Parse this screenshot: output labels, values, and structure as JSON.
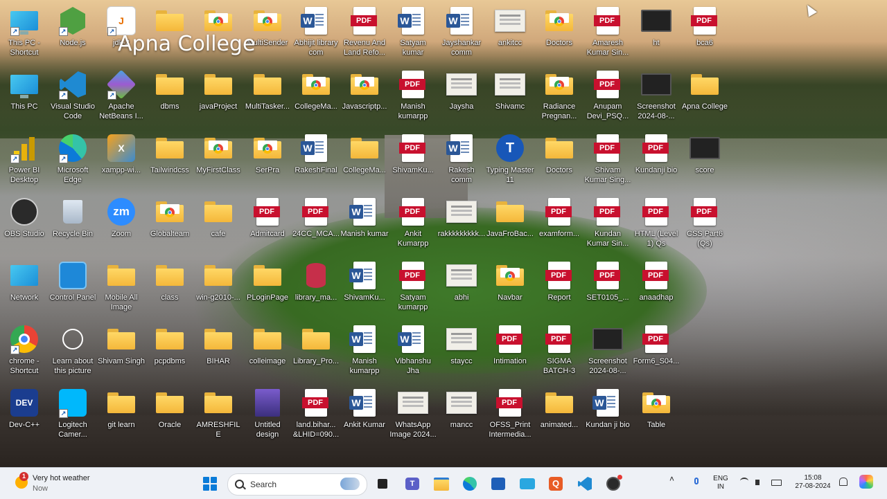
{
  "watermark": "Apna College",
  "desktop_icons": [
    {
      "name": "this-pc-shortcut-icon",
      "label": "This PC - Shortcut",
      "type": "pc",
      "shortcut": true
    },
    {
      "name": "nodejs-icon",
      "label": "Node.js",
      "type": "node",
      "shortcut": true
    },
    {
      "name": "jdk-icon",
      "label": "jdk-2",
      "type": "java",
      "shortcut": true
    },
    {
      "name": "folder-icon",
      "label": "",
      "type": "folder"
    },
    {
      "name": "folder-chrome-icon",
      "label": "",
      "type": "folder-chrome"
    },
    {
      "name": "folder-chrome-icon",
      "label": "MultiSender",
      "type": "folder-chrome"
    },
    {
      "name": "word-doc-icon",
      "label": "Abhijit library com",
      "type": "word"
    },
    {
      "name": "pdf-icon",
      "label": "Revenu And Land Refo...",
      "type": "pdf"
    },
    {
      "name": "word-doc-icon",
      "label": "Satyam kumar",
      "type": "word"
    },
    {
      "name": "word-doc-icon",
      "label": "Jayshankar comm",
      "type": "word"
    },
    {
      "name": "image-icon",
      "label": "ankitcc",
      "type": "cert"
    },
    {
      "name": "folder-chrome-icon",
      "label": "Doctors",
      "type": "folder-chrome"
    },
    {
      "name": "pdf-icon",
      "label": "Amaresh Kumar Sin...",
      "type": "pdf"
    },
    {
      "name": "screen-image-icon",
      "label": "ht",
      "type": "screen"
    },
    {
      "name": "pdf-icon",
      "label": "bca6",
      "type": "pdf"
    },
    {
      "name": "this-pc-icon",
      "label": "This PC",
      "type": "pc"
    },
    {
      "name": "vscode-icon",
      "label": "Visual Studio Code",
      "type": "vscode",
      "shortcut": true
    },
    {
      "name": "netbeans-icon",
      "label": "Apache NetBeans I...",
      "type": "netbeans",
      "shortcut": true
    },
    {
      "name": "folder-icon",
      "label": "dbms",
      "type": "folder"
    },
    {
      "name": "folder-icon",
      "label": "javaProject",
      "type": "folder"
    },
    {
      "name": "folder-icon",
      "label": "MultiTasker...",
      "type": "folder"
    },
    {
      "name": "folder-edge-icon",
      "label": "CollegeMa...",
      "type": "folder-chrome"
    },
    {
      "name": "folder-chrome-icon",
      "label": "Javascriptp...",
      "type": "folder-chrome"
    },
    {
      "name": "pdf-icon",
      "label": "Manish kumarpp",
      "type": "pdf"
    },
    {
      "name": "image-icon",
      "label": "Jaysha",
      "type": "cert"
    },
    {
      "name": "image-icon",
      "label": "Shivamc",
      "type": "cert"
    },
    {
      "name": "folder-chrome-icon",
      "label": "Radiance Pregnan...",
      "type": "folder-chrome"
    },
    {
      "name": "pdf-icon",
      "label": "Anupam Devi_PSQ...",
      "type": "pdf"
    },
    {
      "name": "screen-image-icon",
      "label": "Screenshot 2024-08-...",
      "type": "screen"
    },
    {
      "name": "folder-icon",
      "label": "Apna College",
      "type": "folder"
    },
    {
      "name": "powerbi-icon",
      "label": "Power BI Desktop",
      "type": "powerbi",
      "shortcut": true
    },
    {
      "name": "edge-icon",
      "label": "Microsoft Edge",
      "type": "edge",
      "shortcut": true
    },
    {
      "name": "xampp-icon",
      "label": "xampp-wi...",
      "type": "xampp"
    },
    {
      "name": "folder-icon",
      "label": "Tailwindcss",
      "type": "folder"
    },
    {
      "name": "folder-chrome-icon",
      "label": "MyFirstClass",
      "type": "folder-chrome"
    },
    {
      "name": "folder-chrome-icon",
      "label": "SerPra",
      "type": "folder-chrome"
    },
    {
      "name": "word-doc-icon",
      "label": "RakeshFinal",
      "type": "word"
    },
    {
      "name": "folder-icon",
      "label": "CollegeMa...",
      "type": "folder"
    },
    {
      "name": "pdf-icon",
      "label": "ShivamKu...",
      "type": "pdf"
    },
    {
      "name": "word-doc-icon",
      "label": "Rakesh comm",
      "type": "word"
    },
    {
      "name": "typing-master-icon",
      "label": "Typing Master 11",
      "type": "typing"
    },
    {
      "name": "folder-icon",
      "label": "Doctors",
      "type": "folder"
    },
    {
      "name": "pdf-icon",
      "label": "Shivam Kumar Sing...",
      "type": "pdf"
    },
    {
      "name": "pdf-icon",
      "label": "Kundanji bio",
      "type": "pdf"
    },
    {
      "name": "screen-image-icon",
      "label": "score",
      "type": "screen"
    },
    {
      "name": "obs-icon",
      "label": "OBS Studio",
      "type": "obs"
    },
    {
      "name": "recycle-bin-icon",
      "label": "Recycle Bin",
      "type": "recycle"
    },
    {
      "name": "zoom-icon",
      "label": "Zoom",
      "type": "zoom"
    },
    {
      "name": "folder-chrome-icon",
      "label": "Globalteam",
      "type": "folder-chrome"
    },
    {
      "name": "folder-icon",
      "label": "cafe",
      "type": "folder"
    },
    {
      "name": "pdf-icon",
      "label": "Admitcard",
      "type": "pdf"
    },
    {
      "name": "pdf-icon",
      "label": "24CC_MCA...",
      "type": "pdf"
    },
    {
      "name": "word-doc-icon",
      "label": "Manish kumar",
      "type": "word"
    },
    {
      "name": "pdf-icon",
      "label": "Ankit Kumarpp",
      "type": "pdf"
    },
    {
      "name": "image-icon",
      "label": "rakkkkkkkkk...",
      "type": "cert"
    },
    {
      "name": "folder-icon",
      "label": "JavaFroBac...",
      "type": "folder"
    },
    {
      "name": "pdf-icon",
      "label": "examform...",
      "type": "pdf"
    },
    {
      "name": "pdf-icon",
      "label": "Kundan Kumar Sin...",
      "type": "pdf"
    },
    {
      "name": "pdf-icon",
      "label": "HTML (Level 1) Qs",
      "type": "pdf"
    },
    {
      "name": "pdf-icon",
      "label": "CSS Part6 (Qs)",
      "type": "pdf"
    },
    {
      "name": "network-icon",
      "label": "Network",
      "type": "network"
    },
    {
      "name": "control-panel-icon",
      "label": "Control Panel",
      "type": "control"
    },
    {
      "name": "folder-icon",
      "label": "Mobile All Image",
      "type": "folder"
    },
    {
      "name": "folder-icon",
      "label": "class",
      "type": "folder"
    },
    {
      "name": "folder-icon",
      "label": "win-g2010-...",
      "type": "folder"
    },
    {
      "name": "folder-icon",
      "label": "PLoginPage",
      "type": "folder"
    },
    {
      "name": "database-icon",
      "label": "library_ma...",
      "type": "database"
    },
    {
      "name": "word-doc-icon",
      "label": "ShivamKu...",
      "type": "word"
    },
    {
      "name": "pdf-icon",
      "label": "Satyam kumarpp",
      "type": "pdf"
    },
    {
      "name": "image-icon",
      "label": "abhi",
      "type": "cert"
    },
    {
      "name": "folder-chrome-icon",
      "label": "Navbar",
      "type": "folder-chrome"
    },
    {
      "name": "pdf-icon",
      "label": "Report",
      "type": "pdf"
    },
    {
      "name": "pdf-icon",
      "label": "SET0105_...",
      "type": "pdf"
    },
    {
      "name": "pdf-icon",
      "label": "anaadhap",
      "type": "pdf"
    },
    {
      "name": "chrome-icon",
      "label": "chrome - Shortcut",
      "type": "chrome",
      "shortcut": true
    },
    {
      "name": "learn-about-picture-icon",
      "label": "Learn about this picture",
      "type": "learn"
    },
    {
      "name": "folder-icon",
      "label": "Shivam Singh",
      "type": "folder"
    },
    {
      "name": "folder-icon",
      "label": "pcpdbms",
      "type": "folder"
    },
    {
      "name": "folder-icon",
      "label": "BIHAR",
      "type": "folder"
    },
    {
      "name": "folder-icon",
      "label": "colleimage",
      "type": "folder"
    },
    {
      "name": "folder-icon",
      "label": "Library_Pro...",
      "type": "folder"
    },
    {
      "name": "word-doc-icon",
      "label": "Manish kumarpp",
      "type": "word"
    },
    {
      "name": "word-doc-icon",
      "label": "Vibhanshu Jha",
      "type": "word"
    },
    {
      "name": "image-icon",
      "label": "staycc",
      "type": "cert"
    },
    {
      "name": "pdf-icon",
      "label": "Intimation",
      "type": "pdf"
    },
    {
      "name": "pdf-icon",
      "label": "SIGMA BATCH-3",
      "type": "pdf"
    },
    {
      "name": "screen-image-icon",
      "label": "Screenshot 2024-08-...",
      "type": "screen"
    },
    {
      "name": "pdf-icon",
      "label": "Form6_S04...",
      "type": "pdf"
    },
    {
      "name": "devcpp-icon",
      "label": "Dev-C++",
      "type": "dev"
    },
    {
      "name": "logitech-camera-icon",
      "label": "Logitech Camer...",
      "type": "logi",
      "shortcut": true
    },
    {
      "name": "folder-icon",
      "label": "git learn",
      "type": "folder"
    },
    {
      "name": "folder-icon",
      "label": "Oracle",
      "type": "folder"
    },
    {
      "name": "folder-icon",
      "label": "AMRESHFILE",
      "type": "folder"
    },
    {
      "name": "avatar-image-icon",
      "label": "Untitled design",
      "type": "avatar"
    },
    {
      "name": "pdf-icon",
      "label": "land.bihar... &LHID=090...",
      "type": "pdf"
    },
    {
      "name": "word-doc-icon",
      "label": "Ankit Kumar",
      "type": "word"
    },
    {
      "name": "image-icon",
      "label": "WhatsApp Image 2024...",
      "type": "cert"
    },
    {
      "name": "image-icon",
      "label": "mancc",
      "type": "cert"
    },
    {
      "name": "pdf-icon",
      "label": "OFSS_Print Intermedia...",
      "type": "pdf"
    },
    {
      "name": "folder-icon",
      "label": "animated...",
      "type": "folder"
    },
    {
      "name": "word-doc-icon",
      "label": "Kundan ji bio",
      "type": "word"
    },
    {
      "name": "folder-chrome-icon",
      "label": "Table",
      "type": "folder-chrome"
    }
  ],
  "taskbar": {
    "weather_title": "Very hot weather",
    "weather_sub": "Now",
    "weather_badge": "1",
    "search_placeholder": "Search",
    "pinned": [
      "task-view-icon",
      "teams-icon",
      "file-explorer-icon",
      "edge-icon",
      "store-icon",
      "app-icon",
      "quiz-icon",
      "vscode-icon",
      "obs-icon"
    ],
    "lang_1": "ENG",
    "lang_2": "IN",
    "time": "15:08",
    "date": "27-08-2024"
  }
}
